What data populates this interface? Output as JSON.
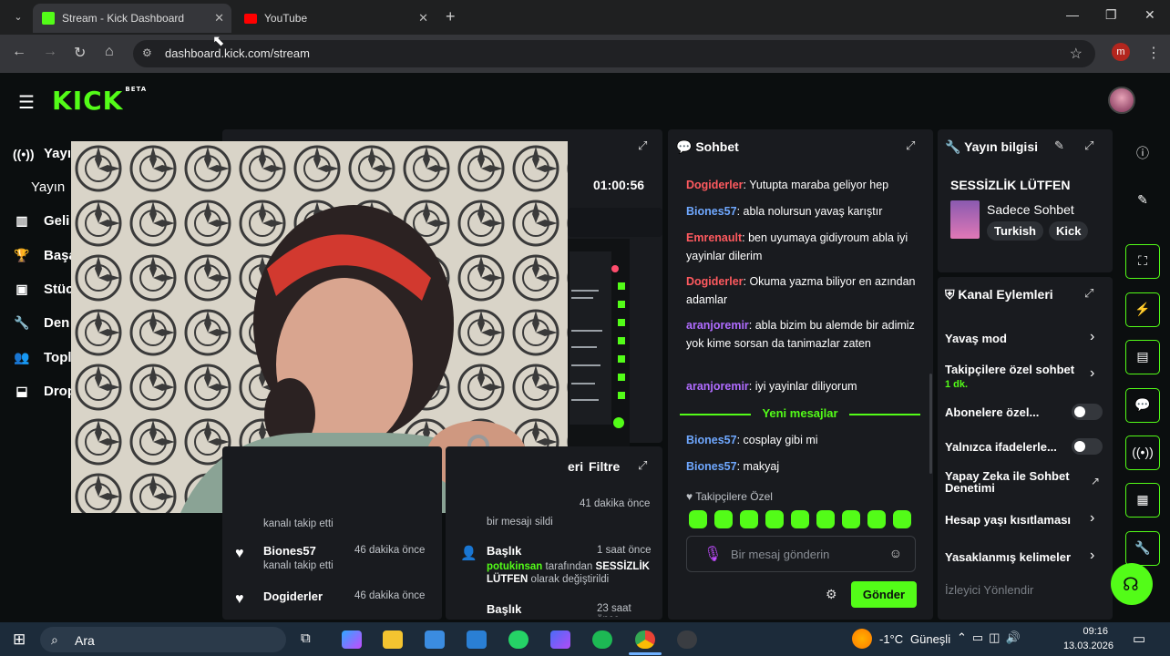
{
  "browser": {
    "tabs": [
      {
        "title": "Stream - Kick Dashboard",
        "favicon": "kick-icon",
        "color": "#53fc18"
      },
      {
        "title": "YouTube",
        "favicon": "youtube-icon",
        "color": "#ff0000"
      }
    ],
    "url": "dashboard.kick.com/stream",
    "profile_initial": "m"
  },
  "app": {
    "logo": "KICK",
    "logo_badge": "BETA",
    "accent": "#53fc18"
  },
  "sidebar": {
    "items": [
      {
        "label": "Yayın",
        "icon": "broadcast-icon"
      },
      {
        "label": "Yayın",
        "icon": ""
      },
      {
        "label": "Geli",
        "icon": "chart-icon"
      },
      {
        "label": "Başa",
        "icon": "trophy-icon"
      },
      {
        "label": "Stüc",
        "icon": "studio-icon"
      },
      {
        "label": "Den",
        "icon": "wrench-icon"
      },
      {
        "label": "Topl",
        "icon": "community-icon"
      },
      {
        "label": "Drop",
        "icon": "drops-icon"
      }
    ]
  },
  "stream": {
    "timer": "01:00:56"
  },
  "chat": {
    "title": "Sohbet",
    "messages": [
      {
        "user": "Dogiderler",
        "color": "#ff5a5f",
        "text": ": Yutupta maraba geliyor hep"
      },
      {
        "user": "Biones57",
        "color": "#6fa8ff",
        "text": ": abla nolursun yavaş karıştır"
      },
      {
        "user": "Emrenault",
        "color": "#ff5a5f",
        "text": ": ben uyumaya gidiyroum abla iyi yayinlar dilerim"
      },
      {
        "user": "Dogiderler",
        "color": "#ff5a5f",
        "text": ": Okuma yazma biliyor en azından adamlar"
      },
      {
        "user": "aranjoremir",
        "color": "#b06cff",
        "text": ": abla bizim bu alemde bir adimiz yok kime sorsan da tanimazlar zaten"
      },
      {
        "user": "aranjoremir",
        "color": "#b06cff",
        "text": ": iyi yayinlar diliyorum"
      }
    ],
    "new_messages_label": "Yeni mesajlar",
    "new_messages": [
      {
        "user": "Biones57",
        "color": "#6fa8ff",
        "text": ": cosplay gibi mi"
      },
      {
        "user": "Biones57",
        "color": "#6fa8ff",
        "text": ": makyaj"
      }
    ],
    "followers_only_label": "Takipçilere Özel",
    "input_placeholder": "Bir mesaj gönderin",
    "send_label": "Gönder"
  },
  "stream_info": {
    "title": "Yayın bilgisi",
    "stream_title": "SESSİZLİK LÜTFEN",
    "category": "Sadece Sohbet",
    "tags": [
      "Turkish",
      "Kick"
    ]
  },
  "channel_actions": {
    "title": "Kanal Eylemleri",
    "items": [
      {
        "label": "Yavaş mod",
        "control": "chevron"
      },
      {
        "label": "Takipçilere özel sohbet",
        "sub": "1 dk.",
        "control": "chevron"
      },
      {
        "label": "Abonelere özel...",
        "control": "toggle"
      },
      {
        "label": "Yalnızca ifadelerle...",
        "control": "toggle"
      },
      {
        "label": "Yapay Zeka ile Sohbet Denetimi",
        "control": "external"
      },
      {
        "label": "Hesap yaşı kısıtlaması",
        "control": "chevron"
      },
      {
        "label": "Yasaklanmış kelimeler",
        "control": "chevron"
      },
      {
        "label": "İzleyici Yönlendir",
        "control": "none"
      }
    ]
  },
  "activity": {
    "filter_label": "Filtre",
    "header_fragment": "eri",
    "events": [
      {
        "name": "Biones57",
        "sub": "kanalı takip etti",
        "time": "46 dakika önce"
      },
      {
        "name": "Dogiderler",
        "sub": "kanalı takip etti",
        "time": "46 dakika önce"
      }
    ],
    "top_follow_sub": "kanalı takip etti",
    "mod_events": [
      {
        "sub": "bir mesajı sildi",
        "time": "41 dakika önce"
      },
      {
        "name": "Başlık",
        "actor": "potukinsan",
        "sub_mid": " tarafından ",
        "value": "SESSİZLİK LÜTFEN",
        "sub_end": " olarak değiştirildi",
        "time": "1 saat önce"
      },
      {
        "name": "Başlık",
        "time": "23 saat önce"
      }
    ]
  },
  "taskbar": {
    "search": "Ara",
    "weather": "-1°C",
    "weather_label": "Güneşli",
    "time": "09:16",
    "date": "13.03.2026"
  }
}
